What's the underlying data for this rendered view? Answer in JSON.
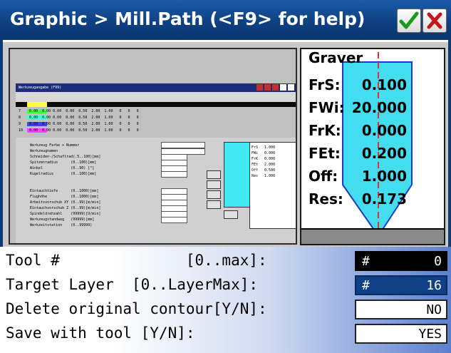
{
  "window": {
    "title": "Graphic > Mill.Path (<F9> for help)",
    "ok_label": "✓",
    "cancel_label": "✗",
    "accent": "#0d3f80"
  },
  "preview": {
    "dialog_title": "Werkzeugangabe (F99)",
    "rows": [
      "7    0.00  0.00 0.00  0.00  0.50  2.00  1.00   0   0   0",
      "8    0.00  0.00 0.00  0.00  0.50  2.00  1.00   0   0   0",
      "9    0.00  0.00 0.00  0.00  0.50  2.00  1.00   0   0   0",
      "10   0.00  0.00 0.00  0.00  0.50  2.00  1.00   0   0   0"
    ],
    "fields": [
      "Werkzeug Farbe + Nummer",
      "Werkzeugnamen",
      "Schneiden-/Schaftrad(.5..100)[mm]",
      "Spitzenradius      (0..100)[mm]",
      "Winkel             (0..90) [°]",
      "Kugelradius        (0..100)[mm]",
      "Eintauchtiefe      (0..1000)[mm]",
      "Flughöhe           (0..1000)[mm]",
      "Arbeitsvorschub XY (0..99)[m/min]",
      "Eintauchvorschub Z (0..99)[m/min]",
      "Spindeldrehzahl    (99999)[U/min]",
      "Werkzeugstandweg   (99999)[mm]",
      "Werkzeitstation    (0..99999)"
    ],
    "mini_values": [
      "1.000",
      "0.000",
      "0.000",
      "2.000",
      "0.500",
      "1.000"
    ],
    "mini_labels": [
      "FrS",
      "FWi",
      "FrK",
      "FEt",
      "Off",
      "Res"
    ]
  },
  "tool_params": [
    {
      "label": "Graver",
      "value": ""
    },
    {
      "label": "FrS:",
      "value": "0.100"
    },
    {
      "label": "FWi:",
      "value": "20.000"
    },
    {
      "label": "FrK:",
      "value": "0.000"
    },
    {
      "label": "FEt:",
      "value": "0.200"
    },
    {
      "label": "Off:",
      "value": "1.000"
    },
    {
      "label": "Res:",
      "value": "0.173"
    }
  ],
  "form": {
    "rows": [
      {
        "label": "Tool #              [0..max]:",
        "prefix": "#",
        "value": "0"
      },
      {
        "label": "Target Layer  [0..LayerMax]:",
        "prefix": "#",
        "value": "16"
      },
      {
        "label": "Delete original contour[Y/N]:",
        "prefix": "",
        "value": "NO"
      },
      {
        "label": "Save with tool [Y/N]:",
        "prefix": "",
        "value": "YES"
      }
    ]
  },
  "colors": {
    "tool_fill": "#44ddf0",
    "tool_stroke": "#1a3ac8",
    "axis_line": "#e03030",
    "active_box": "#000000",
    "selected_box": "#0f3f85"
  }
}
